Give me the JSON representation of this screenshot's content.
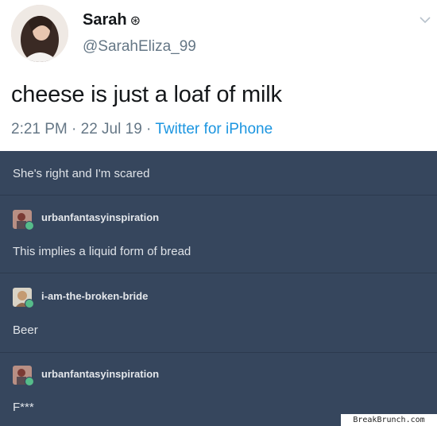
{
  "tweet": {
    "display_name": "Sarah",
    "badge": "⊛",
    "handle": "@SarahEliza_99",
    "text": "cheese is just a loaf of milk",
    "time_date": "2:21 PM · 22 Jul 19 · ",
    "source": "Twitter for iPhone"
  },
  "thread": {
    "first_text": "She's right and I'm scared",
    "replies": [
      {
        "username": "urbanfantasyinspiration",
        "text": "This implies a liquid form of bread"
      },
      {
        "username": "i-am-the-broken-bride",
        "text": "Beer"
      },
      {
        "username": "urbanfantasyinspiration",
        "text": "F***"
      }
    ]
  },
  "watermark": "BreakBrunch.com",
  "colors": {
    "tumblr_bg": "#36465d",
    "twitter_blue": "#1b95e0",
    "badge_green": "#56bc8a"
  },
  "icons": [
    "avatar-sarah",
    "chevron-down-icon",
    "user-avatar-icon",
    "online-dot-icon"
  ]
}
